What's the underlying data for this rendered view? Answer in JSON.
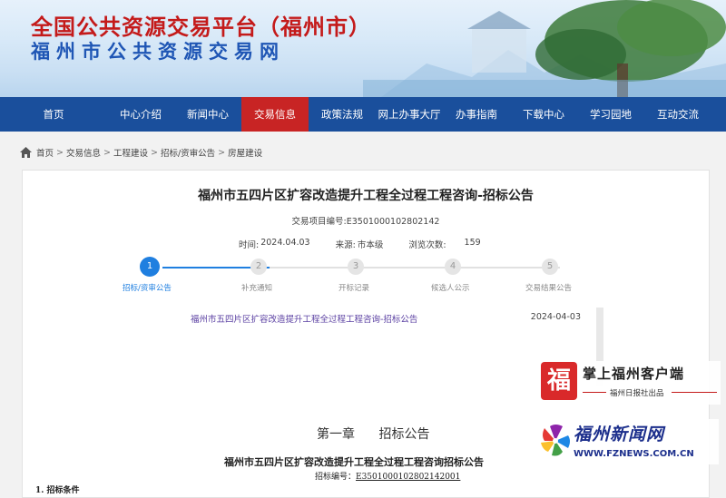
{
  "header": {
    "title_cn": "全国公共资源交易平台（福州市）",
    "subtitle_cn": "福州市公共资源交易网"
  },
  "nav": {
    "items": [
      "首页",
      "中心介绍",
      "新闻中心",
      "交易信息",
      "政策法规",
      "网上办事大厅",
      "办事指南",
      "下载中心",
      "学习园地",
      "互动交流"
    ],
    "active_index": 3
  },
  "breadcrumb": [
    "首页",
    "交易信息",
    "工程建设",
    "招标/资审公告",
    "房屋建设"
  ],
  "article": {
    "title": "福州市五四片区扩容改造提升工程全过程工程咨询-招标公告",
    "project_no": "交易项目编号:E3501000102802142",
    "time_label": "时间:",
    "time": "2024.04.03",
    "source_label": "来源:",
    "source": "市本级",
    "views_label": "浏览次数:",
    "views": "159"
  },
  "steps": [
    {
      "num": "1",
      "label": "招标/资审公告",
      "active": true
    },
    {
      "num": "2",
      "label": "补充通知",
      "active": false
    },
    {
      "num": "3",
      "label": "开标记录",
      "active": false
    },
    {
      "num": "4",
      "label": "候选人公示",
      "active": false
    },
    {
      "num": "5",
      "label": "交易结果公告",
      "active": false
    }
  ],
  "notice": {
    "link": "福州市五四片区扩容改造提升工程全过程工程咨询-招标公告",
    "date": "2024-04-03"
  },
  "document": {
    "chapter": "第一章",
    "chapter_title": "招标公告",
    "title": "福州市五四片区扩容改造提升工程全过程工程咨询招标公告",
    "no_label": "招标编号：",
    "no_value": "E3501000102802142001",
    "section": "1. 招标条件"
  },
  "ads": {
    "app_title": "掌上福州客户端",
    "app_sub": "福州日报社出品",
    "app_logo": "福",
    "news_title": "福州新闻网",
    "news_url": "WWW.FZNEWS.COM.CN"
  },
  "colors": {
    "nav_bg": "#1a4f9c",
    "nav_active": "#c82424",
    "title_red": "#c41a1a",
    "title_blue": "#1f56b5",
    "step_active": "#1f7fe0"
  }
}
